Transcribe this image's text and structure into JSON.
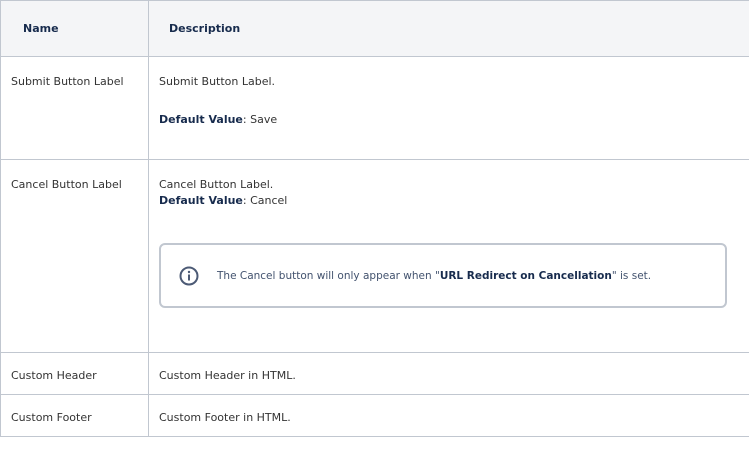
{
  "table": {
    "headers": {
      "name": "Name",
      "description": "Description"
    },
    "rows": [
      {
        "name": "Submit Button Label",
        "description": "Submit Button Label.",
        "default_label": "Default Value",
        "default_value": ": Save"
      },
      {
        "name": "Cancel Button Label",
        "description": "Cancel Button Label.",
        "default_label": "Default Value",
        "default_value": ": Cancel",
        "info": {
          "icon": "info-icon",
          "text_before": "The Cancel button will only appear when \"",
          "text_strong": "URL Redirect on Cancellation",
          "text_after": "\" is set."
        }
      },
      {
        "name": "Custom Header",
        "description": "Custom Header in HTML."
      },
      {
        "name": "Custom Footer",
        "description": "Custom Footer in HTML."
      }
    ]
  },
  "colors": {
    "border": "#c1c7d0",
    "header_bg": "#f4f5f7",
    "info_icon": "#4c5a75"
  }
}
